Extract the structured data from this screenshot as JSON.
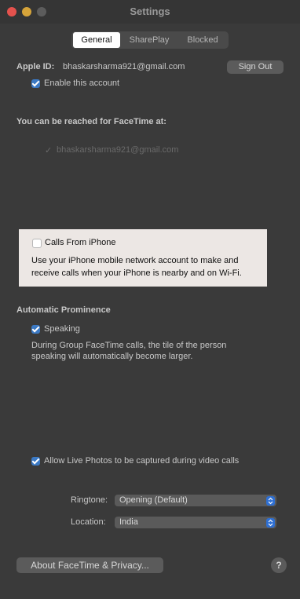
{
  "window": {
    "title": "Settings"
  },
  "tabs": [
    {
      "label": "General"
    },
    {
      "label": "SharePlay"
    },
    {
      "label": "Blocked"
    }
  ],
  "account": {
    "apple_id_label": "Apple ID:",
    "apple_id_value": "bhaskarsharma921@gmail.com",
    "sign_out_label": "Sign Out",
    "enable_label": "Enable this account"
  },
  "reach": {
    "heading": "You can be reached for FaceTime at:",
    "email": "bhaskarsharma921@gmail.com"
  },
  "calls": {
    "label": "Calls From iPhone",
    "description_line1": "Use your iPhone mobile network account to make and",
    "description_line2": "receive calls when your iPhone is nearby and on Wi-Fi."
  },
  "prominence": {
    "heading": "Automatic Prominence",
    "speaking_label": "Speaking",
    "description_line1": "During Group FaceTime calls, the tile of the person",
    "description_line2": "speaking will automatically become larger."
  },
  "live_photos": {
    "label": "Allow Live Photos to be captured during video calls"
  },
  "ringtone": {
    "label": "Ringtone:",
    "value": "Opening (Default)"
  },
  "location": {
    "label": "Location:",
    "value": "India"
  },
  "footer": {
    "about_label": "About FaceTime & Privacy...",
    "help_label": "?"
  },
  "colors": {
    "accent": "#3b79c4",
    "close": "#e4524d",
    "minimize": "#d6a43a",
    "zoom": "#5c5c5c"
  },
  "icons": {
    "stepper": "updown-chevron-icon",
    "check": "checkmark-icon"
  }
}
